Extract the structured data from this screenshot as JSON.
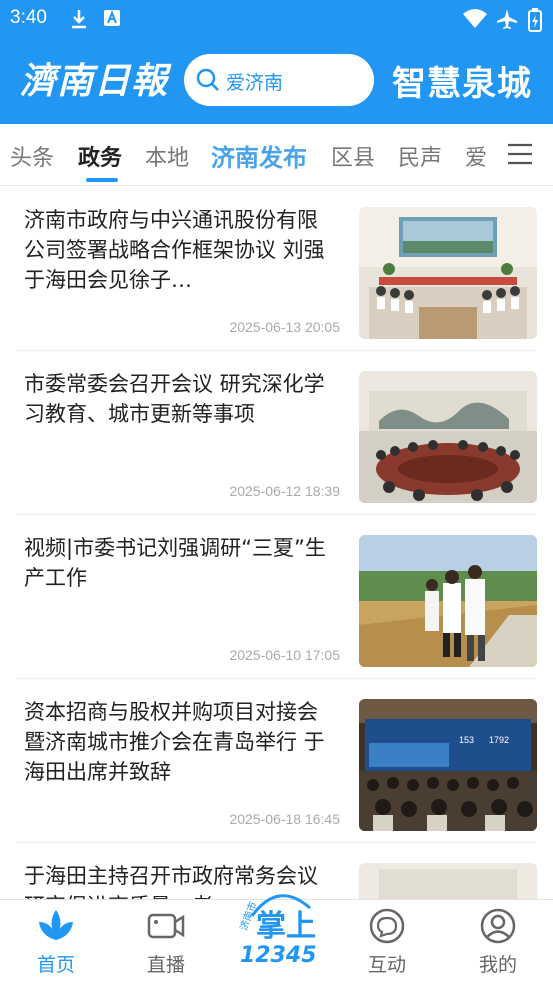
{
  "status": {
    "time": "3:40"
  },
  "header": {
    "logo_left": "濟南日報",
    "search_placeholder": "爱济南",
    "logo_right": "智慧泉城"
  },
  "tabs": [
    {
      "label": "头条"
    },
    {
      "label": "政务"
    },
    {
      "label": "本地"
    },
    {
      "label": "济南发布"
    },
    {
      "label": "区县"
    },
    {
      "label": "民声"
    },
    {
      "label": "爱"
    }
  ],
  "feed": [
    {
      "title": "济南市政府与中兴通讯股份有限公司签署战略合作框架协议 刘强于海田会见徐子…",
      "date": "2025-06-13 20:05"
    },
    {
      "title": "市委常委会召开会议 研究深化学习教育、城市更新等事项",
      "date": "2025-06-12 18:39"
    },
    {
      "title": "视频|市委书记刘强调研“三夏”生产工作",
      "date": "2025-06-10 17:05"
    },
    {
      "title": "资本招商与股权并购项目对接会暨济南城市推介会在青岛举行 于海田出席并致辞",
      "date": "2025-06-18 16:45"
    },
    {
      "title": "于海田主持召开市政府常务会议 研究促进高质量…者",
      "date": ""
    }
  ],
  "thumb4_text": {
    "n1": "153",
    "n2": "1792"
  },
  "bottom_nav": [
    {
      "label": "首页"
    },
    {
      "label": "直播"
    },
    {
      "label": "互动"
    },
    {
      "label": "我的"
    }
  ],
  "center_badge": {
    "small": "济南市",
    "big": "掌上",
    "num": "12345"
  },
  "colors": {
    "primary": "#2196f3",
    "tab_highlight": "#4aa3e8"
  }
}
